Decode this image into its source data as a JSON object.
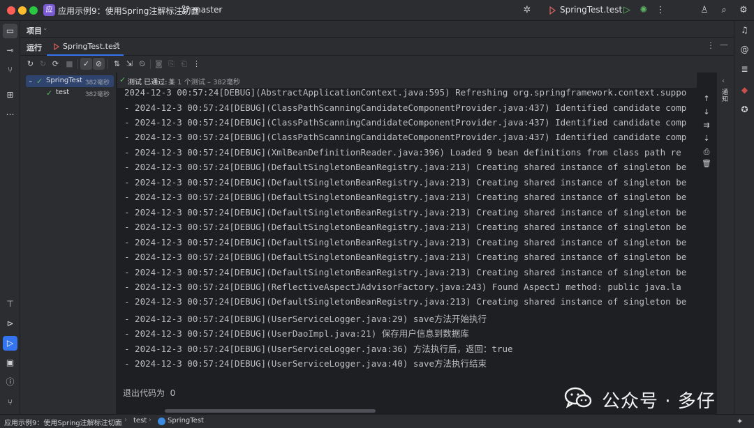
{
  "window": {
    "project_badge": "应",
    "project_name": "应用示例9：使用Spring注解标注切面",
    "branch": "master",
    "run_config": "SpringTest.test"
  },
  "project_panel": {
    "label": "项目"
  },
  "run_panel": {
    "label": "运行",
    "tab_label": "SpringTest.test"
  },
  "tree": {
    "items": [
      {
        "label": "SpringTest",
        "time": "382毫秒"
      },
      {
        "label": "test",
        "time": "382毫秒"
      }
    ]
  },
  "status": {
    "main": "测试 已通过: 1",
    "sub": "共 1 个测试 – 382毫秒"
  },
  "console": {
    "lines": [
      "2024-12-3 00:57:24[DEBUG](AbstractApplicationContext.java:595) Refreshing org.springframework.context.suppo",
      "- 2024-12-3 00:57:24[DEBUG](ClassPathScanningCandidateComponentProvider.java:437) Identified candidate comp",
      "- 2024-12-3 00:57:24[DEBUG](ClassPathScanningCandidateComponentProvider.java:437) Identified candidate comp",
      "- 2024-12-3 00:57:24[DEBUG](ClassPathScanningCandidateComponentProvider.java:437) Identified candidate comp",
      "- 2024-12-3 00:57:24[DEBUG](XmlBeanDefinitionReader.java:396) Loaded 9 bean definitions from class path re",
      "- 2024-12-3 00:57:24[DEBUG](DefaultSingletonBeanRegistry.java:213) Creating shared instance of singleton be",
      "- 2024-12-3 00:57:24[DEBUG](DefaultSingletonBeanRegistry.java:213) Creating shared instance of singleton be",
      "- 2024-12-3 00:57:24[DEBUG](DefaultSingletonBeanRegistry.java:213) Creating shared instance of singleton be",
      "- 2024-12-3 00:57:24[DEBUG](DefaultSingletonBeanRegistry.java:213) Creating shared instance of singleton be",
      "- 2024-12-3 00:57:24[DEBUG](DefaultSingletonBeanRegistry.java:213) Creating shared instance of singleton be",
      "- 2024-12-3 00:57:24[DEBUG](DefaultSingletonBeanRegistry.java:213) Creating shared instance of singleton be",
      "- 2024-12-3 00:57:24[DEBUG](DefaultSingletonBeanRegistry.java:213) Creating shared instance of singleton be",
      "- 2024-12-3 00:57:24[DEBUG](DefaultSingletonBeanRegistry.java:213) Creating shared instance of singleton be",
      "- 2024-12-3 00:57:24[DEBUG](ReflectiveAspectJAdvisorFactory.java:243) Found AspectJ method: public java.la",
      "- 2024-12-3 00:57:24[DEBUG](DefaultSingletonBeanRegistry.java:213) Creating shared instance of singleton be",
      "- 2024-12-3 00:57:24[DEBUG](UserServiceLogger.java:29) save方法开始执行",
      "- 2024-12-3 00:57:24[DEBUG](UserDaoImpl.java:21) 保存用户信息到数据库",
      "- 2024-12-3 00:57:24[DEBUG](UserServiceLogger.java:36) 方法执行后，返回：true",
      "- 2024-12-3 00:57:24[DEBUG](UserServiceLogger.java:40) save方法执行结束"
    ],
    "exit_text": "退出代码为  0"
  },
  "notifications": {
    "label": "通知"
  },
  "watermark": {
    "text": "公众号 · 多仔"
  },
  "statusbar": {
    "crumbs": [
      "应用示例9：使用Spring注解标注切面",
      "test",
      "SpringTest"
    ]
  },
  "colors": {
    "accent": "#3574f0",
    "pass_green": "#5fb865",
    "project_badge": "#7a5bd1"
  }
}
